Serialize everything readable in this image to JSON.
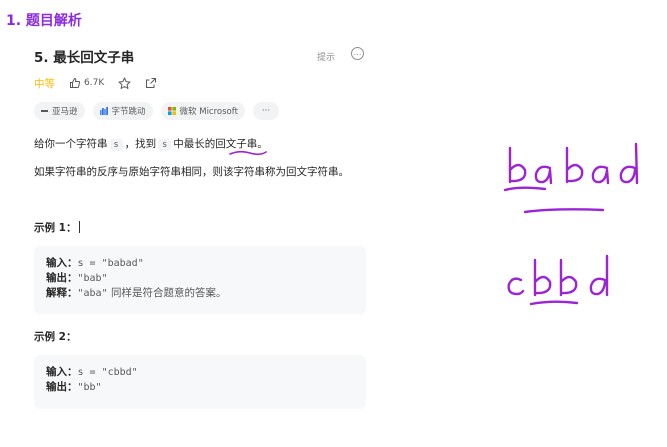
{
  "section": {
    "title": "1. 题目解析"
  },
  "problem": {
    "title": "5. 最长回文子串",
    "hint_label": "提示",
    "more_symbol": "…",
    "difficulty": "中等",
    "likes": "6.7K",
    "tags": [
      "亚马逊",
      "字节跳动",
      "微软 Microsoft"
    ],
    "tags_more": "···"
  },
  "description": {
    "line1": {
      "before": "给你一个字符串",
      "var1": "s",
      "middle": "，找到",
      "var2": "s",
      "after": "中最长的回文子串。"
    },
    "line2": "如果字符串的反序与原始字符串相同，则该字符串称为回文字符串。"
  },
  "examples": [
    {
      "title": "示例 1：",
      "input_label": "输入：",
      "input_value": "s = \"babad\"",
      "output_label": "输出：",
      "output_value": "\"bab\"",
      "explain_label": "解释：",
      "explain_value": "\"aba\"",
      "explain_text": "同样是符合题意的答案。"
    },
    {
      "title": "示例 2：",
      "input_label": "输入：",
      "input_value": "s = \"cbbd\"",
      "output_label": "输出：",
      "output_value": "\"bb\""
    }
  ],
  "handwriting": {
    "word1": [
      "b",
      "a",
      "b",
      "a",
      "d"
    ],
    "word2": [
      "c",
      "b",
      "b",
      "d"
    ],
    "ink_color": "#9b24d6"
  },
  "colors": {
    "accent": "#8a2be2",
    "difficulty": "#ffb800",
    "ink": "#9b24d6"
  }
}
